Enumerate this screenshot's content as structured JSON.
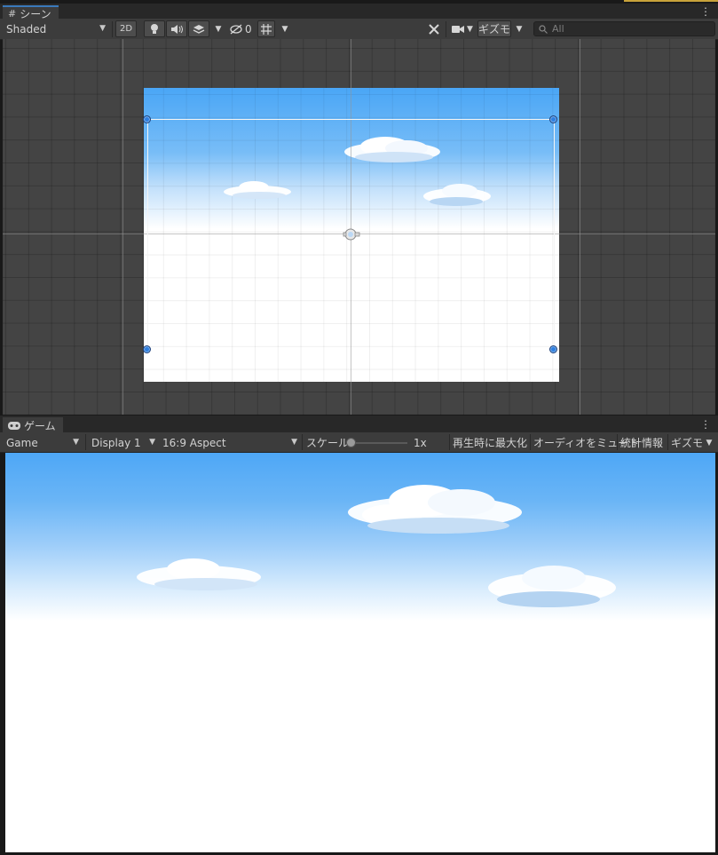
{
  "scene": {
    "tab_icon": "#",
    "tab_label": "シーン",
    "menu_icon": "⋮",
    "toolbar": {
      "draw_mode": "Shaded",
      "btn_2d": "2D",
      "light_icon": "lightbulb-icon",
      "audio_icon": "speaker-icon",
      "effects_icon": "layers-icon",
      "hidden_count": "0",
      "grid_icon": "grid-snap-icon",
      "tools_icon": "tools-icon",
      "camera_icon": "camera-icon",
      "gizmos_label": "ギズモ",
      "search_placeholder": "All"
    }
  },
  "game": {
    "tab_label": "ゲーム",
    "menu_icon": "⋮",
    "toolbar": {
      "game_dropdown": "Game",
      "display_dropdown": "Display 1",
      "aspect_dropdown": "16:9 Aspect",
      "scale_label": "スケール",
      "scale_value": "1x",
      "maximize_on_play": "再生時に最大化",
      "mute_audio": "オーディオをミュート",
      "stats": "統計情報",
      "gizmos_label": "ギズモ"
    }
  },
  "colors": {
    "sky_top": "#4aa6f6",
    "selection_handle": "#2f7fe0",
    "tab_active_accent": "#3a79bb",
    "editor_panel": "#3c3c3c"
  }
}
